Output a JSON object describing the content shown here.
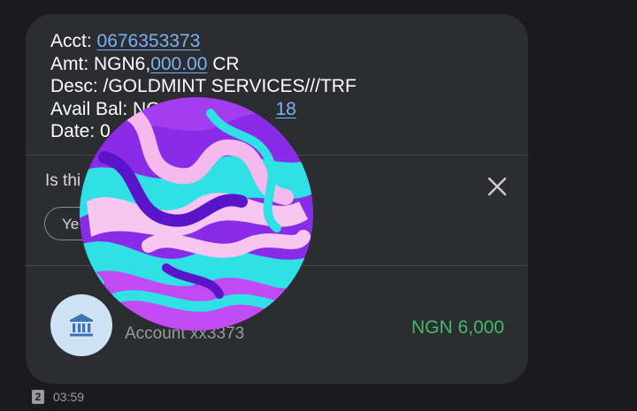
{
  "message": {
    "acct_label": "Acct: ",
    "acct_number": "0676353373",
    "amt_label": "Amt: NGN6,",
    "amt_link": "000.00",
    "amt_suffix": " CR",
    "desc_line": "Desc: /GOLDMINT SERVICES///TRF",
    "bal_prefix": "Avail Bal: NG",
    "bal_link": "18",
    "date_prefix": "Date: 0"
  },
  "prompt": {
    "text": "Is thi",
    "yes_button_label": "Ye",
    "close_icon": "close-icon"
  },
  "account_card": {
    "icon": "bank-icon",
    "title": "",
    "subtitle": "Account xx3373",
    "amount": "NGN 6,000"
  },
  "footer": {
    "sim_number": "2",
    "time": "03:59"
  },
  "colors": {
    "background": "#1b1b1d",
    "bubble": "#2c2d30",
    "link": "#7ab2f5",
    "amount_green": "#43b86a",
    "bank_avatar_bg": "#cfe3f7",
    "bank_icon": "#3f73b3"
  }
}
